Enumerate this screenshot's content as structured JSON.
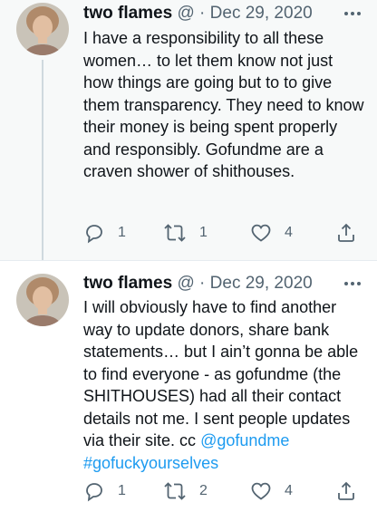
{
  "tweets": [
    {
      "author": "two flames",
      "separator": "@ · ",
      "date": "Dec 29, 2020",
      "text": "I have a responsibility to all these women… to let them know not just how things are going but to to give them transparency. They need to know their money is being spent properly and responsibly. Gofundme are a craven shower of shithouses.",
      "replies": "1",
      "retweets": "1",
      "likes": "4"
    },
    {
      "author": "two flames",
      "separator": "@ · ",
      "date": "Dec 29, 2020",
      "text": "I will obviously have to find another way to update donors, share bank statements… but I ain’t gonna be able to find everyone - as gofundme (the SHITHOUSES) had all their contact details not me. I sent people updates via their site. cc",
      "mention": "@gofundme",
      "hashtag": "#gofuckyourselves",
      "replies": "1",
      "retweets": "2",
      "likes": "4"
    }
  ],
  "icons": {
    "reply": "reply-icon",
    "retweet": "retweet-icon",
    "like": "heart-icon",
    "share": "share-icon",
    "more": "more-icon"
  },
  "colors": {
    "link": "#1d9bf0",
    "secondary_text": "#536471",
    "highlight_bg": "#f7f9f9"
  }
}
